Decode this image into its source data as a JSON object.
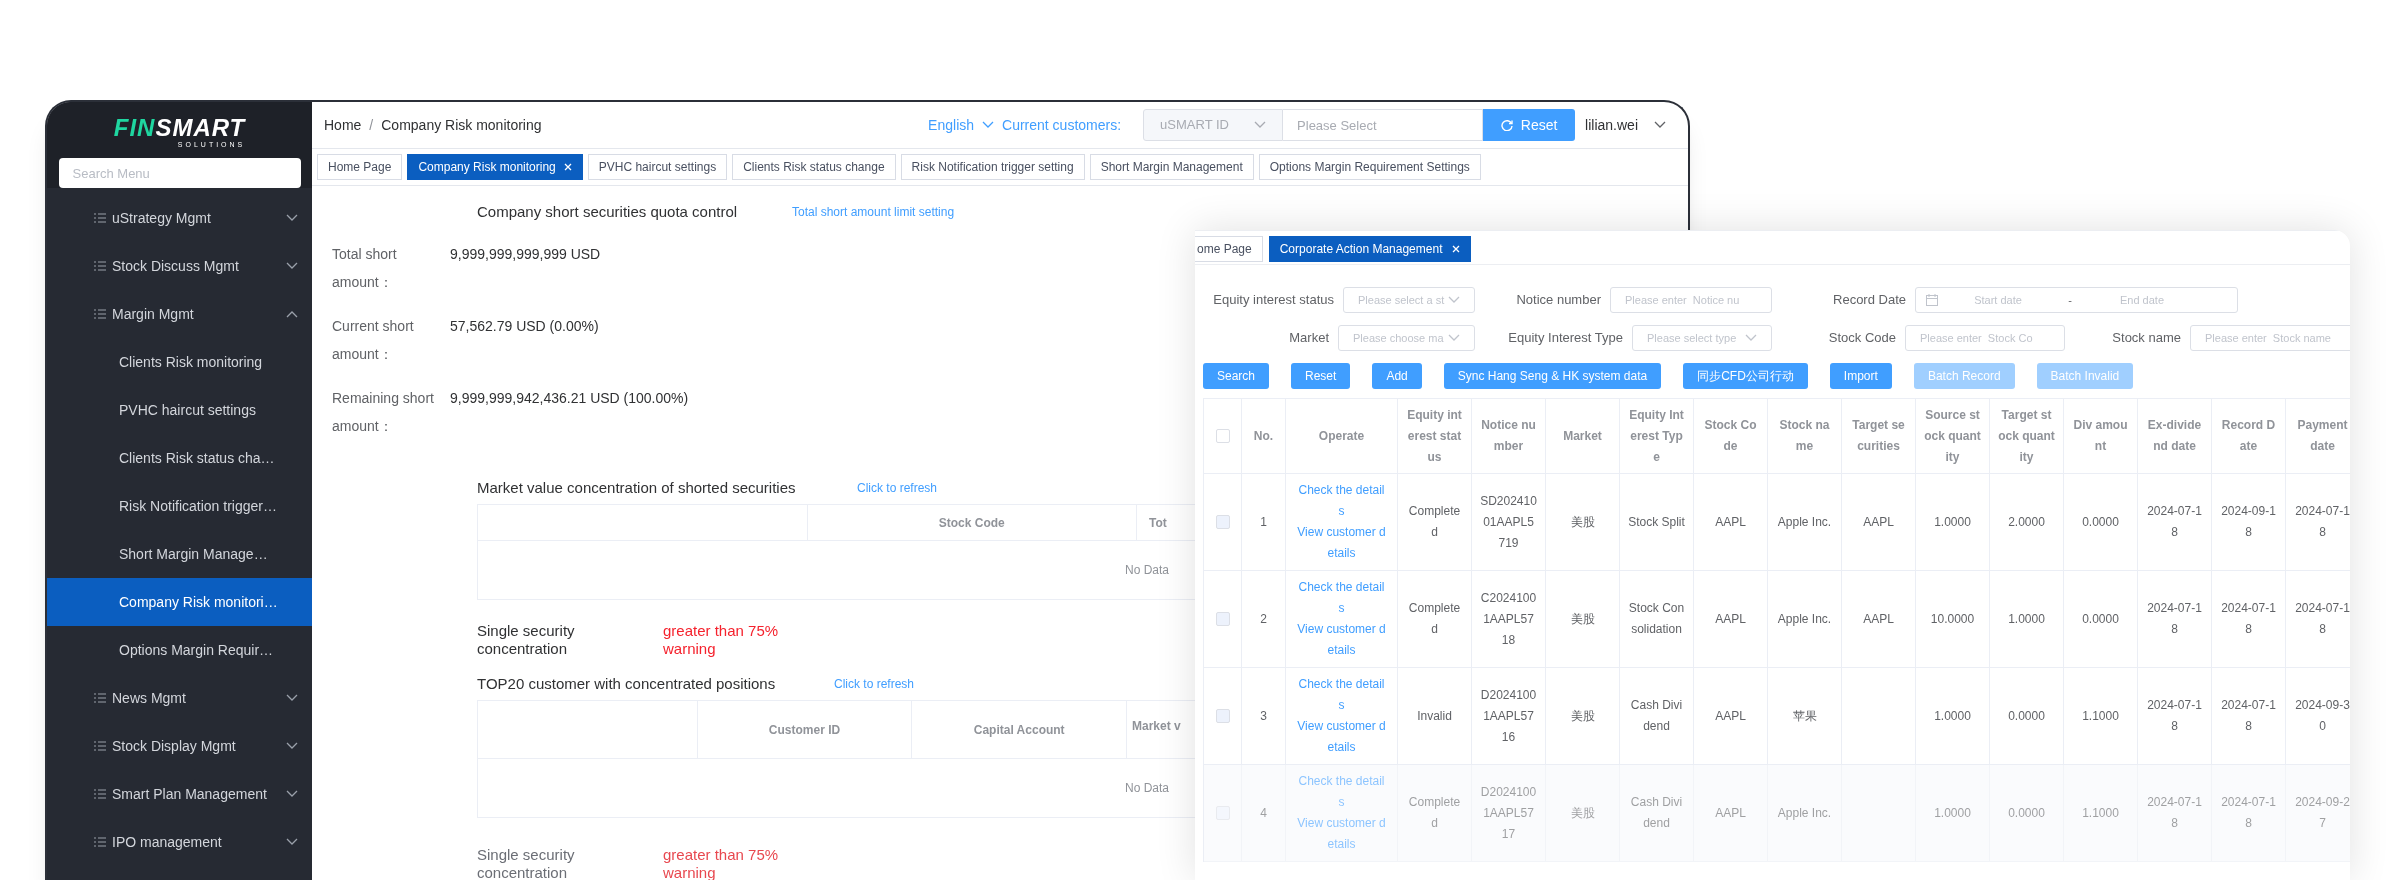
{
  "back_window": {
    "sidebar": {
      "logo": {
        "part_1": "FIN",
        "part_2": "SMART",
        "tagline": "SOLUTIONS"
      },
      "search": {
        "placeholder": "Search Menu"
      },
      "items": [
        {
          "label": "uStrategy Mgmt",
          "expanded": false
        },
        {
          "label": "Stock Discuss Mgmt",
          "expanded": false
        },
        {
          "label": "Margin Mgmt",
          "expanded": true,
          "children": [
            {
              "label": "Clients Risk monitoring",
              "selected": false
            },
            {
              "label": "PVHC haircut settings",
              "selected": false
            },
            {
              "label": "Clients Risk status cha…",
              "selected": false
            },
            {
              "label": "Risk Notification trigger…",
              "selected": false
            },
            {
              "label": "Short Margin Manage…",
              "selected": false
            },
            {
              "label": "Company Risk monitori…",
              "selected": true
            },
            {
              "label": "Options Margin Requir…",
              "selected": false
            }
          ]
        },
        {
          "label": "News Mgmt",
          "expanded": false
        },
        {
          "label": "Stock Display Mgmt",
          "expanded": false
        },
        {
          "label": "Smart Plan Management",
          "expanded": false
        },
        {
          "label": "IPO management",
          "expanded": false
        }
      ]
    },
    "header": {
      "breadcrumb": [
        "Home",
        "Company Risk monitoring"
      ],
      "separator": "/",
      "language": "English",
      "customers_label": "Current customers:",
      "id_select": "uSMART ID",
      "customer_placeholder": "Please Select",
      "reset": "Reset",
      "user": "lilian.wei"
    },
    "tabs": [
      {
        "label": "Home Page",
        "selected": false
      },
      {
        "label": "Company Risk monitoring",
        "selected": true
      },
      {
        "label": "PVHC haircut settings",
        "selected": false
      },
      {
        "label": "Clients Risk status change",
        "selected": false
      },
      {
        "label": "Risk Notification trigger setting",
        "selected": false
      },
      {
        "label": "Short Margin Management",
        "selected": false
      },
      {
        "label": "Options Margin Requirement Settings",
        "selected": false
      }
    ],
    "quota": {
      "title": "Company short securities quota control",
      "link": "Total short amount limit setting",
      "stats": [
        {
          "label": "Total short amount：",
          "value": "9,999,999,999,999 USD"
        },
        {
          "label": "Current short amount：",
          "value": "57,562.79 USD (0.00%)"
        },
        {
          "label": "Remaining short amount：",
          "value": "9,999,999,942,436.21 USD (100.00%)"
        }
      ]
    },
    "sections": [
      {
        "title": "Market value concentration of shorted securities",
        "link": "Click to refresh",
        "columns": [
          "Stock Code",
          "Tot"
        ],
        "empty_text": "No Data",
        "warning_label": "Single security concentration",
        "warning": "greater than 75% warning"
      },
      {
        "title": "TOP20 customer with concentrated positions",
        "link": "Click to refresh",
        "columns": [
          "Customer ID",
          "Capital Account",
          "Market v"
        ],
        "empty_text": "No Data",
        "warning_label": "Single security concentration",
        "warning": "greater than 75% warning"
      }
    ]
  },
  "front_window": {
    "tabs": [
      {
        "label": "ome Page",
        "selected": false
      },
      {
        "label": "Corporate Action Management",
        "selected": true
      }
    ],
    "filter_rows": [
      [
        {
          "label": "Equity interest status",
          "kind": "select",
          "placeholder": "Please select a st"
        },
        {
          "label": "Notice number",
          "kind": "input",
          "placeholder": "Please enter  Notice nu"
        },
        {
          "label": "Record Date",
          "kind": "daterange",
          "start_placeholder": "Start date",
          "separator": "-",
          "end_placeholder": "End date"
        }
      ],
      [
        {
          "label": "Market",
          "kind": "select",
          "placeholder": "Please choose ma"
        },
        {
          "label": "Equity Interest Type",
          "kind": "select",
          "placeholder": "Please select type"
        },
        {
          "label": "Stock Code",
          "kind": "input",
          "placeholder": "Please enter  Stock Co"
        },
        {
          "label": "Stock name",
          "kind": "input",
          "placeholder": "Please enter  Stock name"
        }
      ]
    ],
    "buttons": [
      {
        "label": "Search",
        "disabled": false
      },
      {
        "label": "Reset",
        "disabled": false
      },
      {
        "label": "Add",
        "disabled": false
      },
      {
        "label": "Sync Hang Seng & HK system data",
        "disabled": false
      },
      {
        "label": "同步CFD公司行动",
        "disabled": false
      },
      {
        "label": "Import",
        "disabled": false
      },
      {
        "label": "Batch Record",
        "disabled": true
      },
      {
        "label": "Batch Invalid",
        "disabled": true
      }
    ],
    "table": {
      "select_all_checked": false,
      "columns": [
        "No.",
        "Operate",
        "Equity interest status",
        "Notice number",
        "Market",
        "Equity Interest Type",
        "Stock Code",
        "Stock name",
        "Target securities",
        "Source stock quantity",
        "Target stock quantity",
        "Div amount",
        "Ex-dividend date",
        "Record Date",
        "Payment date"
      ],
      "rows": [
        {
          "checked": false,
          "cells": [
            {
              "text": "1"
            },
            {
              "links": [
                "Check the details",
                "View customer details"
              ]
            },
            {
              "text": "Completed"
            },
            {
              "text": "SD20241001AAPL5719"
            },
            {
              "text": "美股"
            },
            {
              "text": "Stock Split"
            },
            {
              "text": "AAPL"
            },
            {
              "text": "Apple Inc."
            },
            {
              "text": "AAPL"
            },
            {
              "text": "1.0000"
            },
            {
              "text": "2.0000"
            },
            {
              "text": "0.0000"
            },
            {
              "text": "2024-07-18"
            },
            {
              "text": "2024-09-18"
            },
            {
              "text": "2024-07-18"
            }
          ]
        },
        {
          "checked": false,
          "cells": [
            {
              "text": "2"
            },
            {
              "links": [
                "Check the details",
                "View customer details"
              ]
            },
            {
              "text": "Completed"
            },
            {
              "text": "C20241001AAPL5718"
            },
            {
              "text": "美股"
            },
            {
              "text": "Stock Consolidation"
            },
            {
              "text": "AAPL"
            },
            {
              "text": "Apple Inc."
            },
            {
              "text": "AAPL"
            },
            {
              "text": "10.0000"
            },
            {
              "text": "1.0000"
            },
            {
              "text": "0.0000"
            },
            {
              "text": "2024-07-18"
            },
            {
              "text": "2024-07-18"
            },
            {
              "text": "2024-07-18"
            }
          ]
        },
        {
          "checked": false,
          "cells": [
            {
              "text": "3"
            },
            {
              "links": [
                "Check the details",
                "View customer details"
              ]
            },
            {
              "text": "Invalid"
            },
            {
              "text": "D20241001AAPL5716"
            },
            {
              "text": "美股"
            },
            {
              "text": "Cash Dividend"
            },
            {
              "text": "AAPL"
            },
            {
              "text": "苹果"
            },
            {},
            {
              "text": "1.0000"
            },
            {
              "text": "0.0000"
            },
            {
              "text": "1.1000"
            },
            {
              "text": "2024-07-18"
            },
            {
              "text": "2024-07-18"
            },
            {
              "text": "2024-09-30"
            }
          ]
        },
        {
          "checked": false,
          "cells": [
            {
              "text": "4"
            },
            {
              "links": [
                "Check the details",
                "View customer details"
              ]
            },
            {
              "text": "Completed"
            },
            {
              "text": "D20241001AAPL5717"
            },
            {
              "text": "美股"
            },
            {
              "text": "Cash Dividend"
            },
            {
              "text": "AAPL"
            },
            {
              "text": "Apple Inc."
            },
            {},
            {
              "text": "1.0000"
            },
            {
              "text": "0.0000"
            },
            {
              "text": "1.1000"
            },
            {
              "text": "2024-07-18"
            },
            {
              "text": "2024-07-18"
            },
            {
              "text": "2024-09-27"
            }
          ]
        }
      ]
    }
  }
}
